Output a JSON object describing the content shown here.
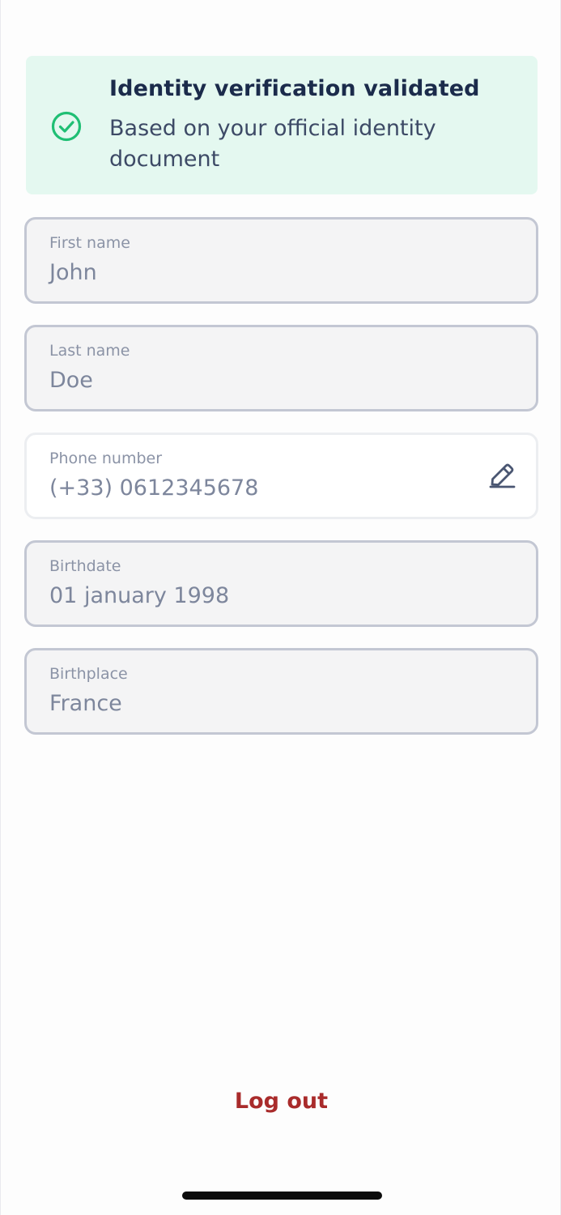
{
  "banner": {
    "title": "Identity verification validated",
    "subtitle": "Based on your official identity document",
    "icon": "check-circle-icon",
    "color": "#e4f8f0",
    "icon_color": "#1fbf74"
  },
  "fields": {
    "first_name": {
      "label": "First name",
      "value": "John"
    },
    "last_name": {
      "label": "Last name",
      "value": "Doe"
    },
    "phone": {
      "label": "Phone number",
      "value": "(+33) 0612345678",
      "icon": "pencil-icon"
    },
    "birthdate": {
      "label": "Birthdate",
      "value": "01 january 1998"
    },
    "birthplace": {
      "label": "Birthplace",
      "value": "France"
    }
  },
  "actions": {
    "logout_label": "Log out",
    "logout_color": "#a92b2b"
  }
}
